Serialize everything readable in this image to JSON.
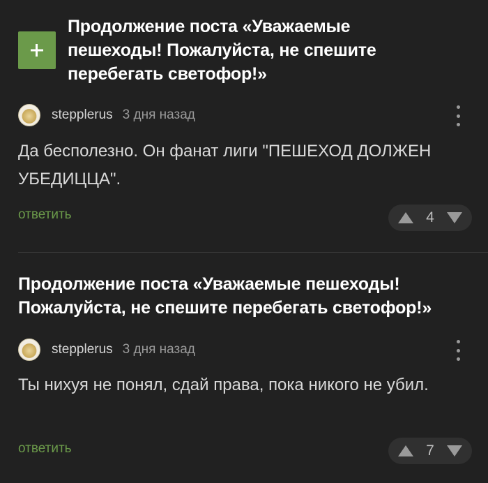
{
  "threads": [
    {
      "title": "Продолжение поста «Уважаемые пешеходы! Пожалуйста, не спешите перебегать светофор!»",
      "comment": {
        "username": "stepplerus",
        "timestamp": "3 дня назад",
        "text": "Да бесполезно. Он фанат лиги \"ПЕШЕХОД ДОЛЖЕН УБЕДИЦЦА\".",
        "reply_label": "ответить",
        "votes": "4"
      }
    },
    {
      "title": "Продолжение поста «Уважаемые пешеходы! Пожалуйста, не спешите перебегать светофор!»",
      "comment": {
        "username": "stepplerus",
        "timestamp": "3 дня назад",
        "text": "Ты нихуя не понял, сдай права, пока никого не убил.",
        "reply_label": "ответить",
        "votes": "7"
      }
    }
  ],
  "colors": {
    "background": "#212121",
    "accent_green": "#6b9a4a",
    "vote_box": "#303030"
  },
  "icons": [
    "plus-icon",
    "avatar",
    "more-vertical-icon",
    "upvote-icon",
    "downvote-icon"
  ]
}
